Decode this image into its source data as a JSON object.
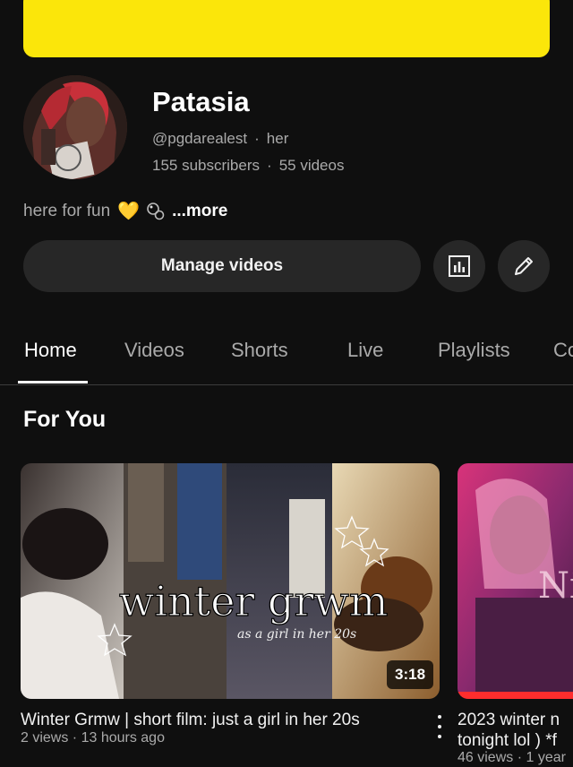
{
  "channel": {
    "name": "Patasia",
    "handle": "@pgdarealest",
    "pronouns": "her",
    "subscribers": "155 subscribers",
    "videos": "55 videos",
    "bio_text": "here for fun",
    "bio_heart": "💛",
    "more_label": "...more",
    "banner_color": "#fbe60a"
  },
  "actions": {
    "manage_label": "Manage videos",
    "analytics_icon": "analytics-icon",
    "edit_icon": "pencil-icon"
  },
  "tabs": [
    {
      "label": "Home",
      "active": true
    },
    {
      "label": "Videos",
      "active": false
    },
    {
      "label": "Shorts",
      "active": false
    },
    {
      "label": "Live",
      "active": false
    },
    {
      "label": "Playlists",
      "active": false
    },
    {
      "label": "Co",
      "active": false
    }
  ],
  "section": {
    "title": "For You"
  },
  "videos": [
    {
      "thumbnail_text": "winter grwm",
      "thumbnail_subtext": "as a girl in her 20s",
      "duration": "3:18",
      "title": "Winter Grmw | short film: just a girl in her 20s",
      "meta": "2 views · 13 hours ago"
    },
    {
      "thumbnail_text": "Nig",
      "title_line1": "2023 winter n",
      "title_line2": "tonight lol ) *f",
      "meta": "46 views · 1 year"
    }
  ]
}
